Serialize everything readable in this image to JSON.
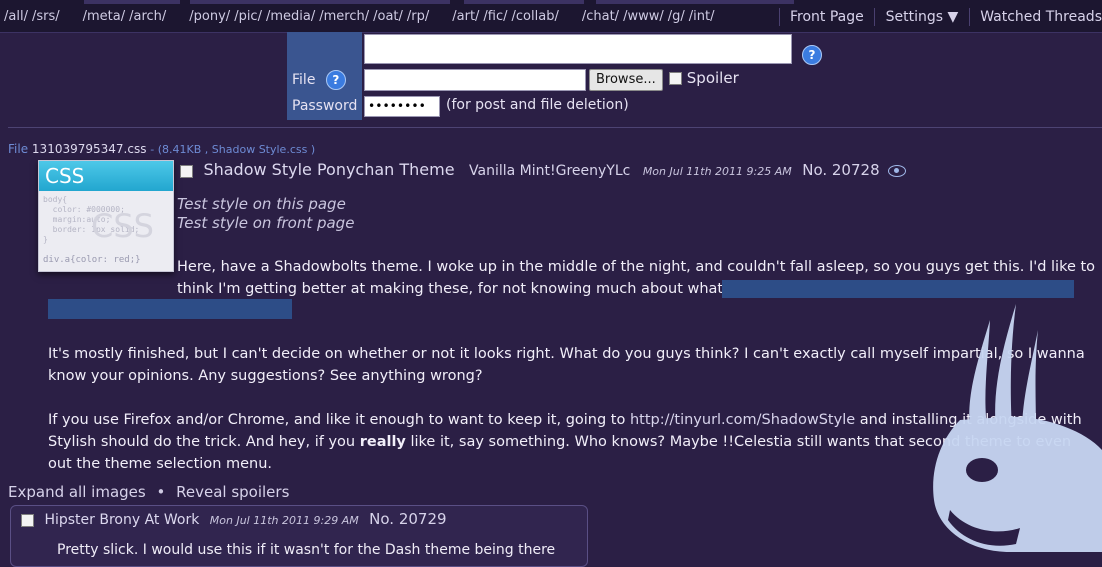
{
  "nav": {
    "groups": [
      [
        "/all/",
        "/srs/"
      ],
      [
        "/meta/",
        "/arch/"
      ],
      [
        "/pony/",
        "/pic/",
        "/media/",
        "/merch/",
        "/oat/",
        "/rp/"
      ],
      [
        "/art/",
        "/fic/",
        "/collab/"
      ],
      [
        "/chat/",
        "/www/",
        "/g/",
        "/int/"
      ]
    ],
    "front_page": "Front Page",
    "settings": "Settings ▼",
    "watched_threads": "Watched Threads"
  },
  "form": {
    "file_label": "File",
    "browse_label": "Browse...",
    "spoiler_label": "Spoiler",
    "password_label": "Password",
    "password_value": "••••••••",
    "password_note": "(for post and file deletion)",
    "help_glyph": "?"
  },
  "post": {
    "file_prefix": "File",
    "file_name": "131039795347.css",
    "file_meta": "- (8.41KB , Shadow Style.css )",
    "thumb": {
      "title": "CSS",
      "code": "body{\n  color: #000000;\n  margin:auto;\n  border: 1px solid;\n}",
      "watermark": "CSS",
      "footer": "div.a{color: red;}"
    },
    "subject": "Shadow Style Ponychan Theme",
    "name": "Vanilla Mint!GreenyYLc",
    "date": "Mon Jul 11th 2011 9:25 AM",
    "number": "No. 20728",
    "test_this": "Test style on this page",
    "test_front": "Test style on front page",
    "body_p1": "Here, have a Shadowbolts theme. I woke up in the middle of the night, and couldn't fall asleep, so you guys get this. I'd like to think I'm getting better at making these, for not knowing much about what I'm doing.",
    "body_p2": "It's mostly finished, but I can't decide on whether or not it looks right. What do you guys think? I can't exactly call myself impartial, so I wanna know your opinions. Any suggestions? See anything wrong?",
    "body_p3_a": "If you use Firefox and/or Chrome, and like it enough to want to keep it, going to ",
    "body_p3_url": "http://tinyurl.com/ShadowStyle",
    "body_p3_b": " and installing it alongside with Stylish should do the trick. And hey, if you ",
    "body_p3_bold": "really",
    "body_p3_c": " like it, say something. Who knows? Maybe !!Celestia still wants that second theme to even out the theme selection menu."
  },
  "controls": {
    "expand": "Expand all images",
    "dot": "•",
    "reveal": "Reveal spoilers"
  },
  "reply": {
    "name": "Hipster Brony At Work",
    "date": "Mon Jul 11th 2011 9:29 AM",
    "number": "No. 20729",
    "text_partial": "Pretty slick. I would use this if it wasn't for the Dash theme being there"
  },
  "colors": {
    "background": "#2b1f45",
    "label_bg": "#3a5590",
    "spoiler": "#2d4d87",
    "mascot": "#c7d6f2"
  }
}
